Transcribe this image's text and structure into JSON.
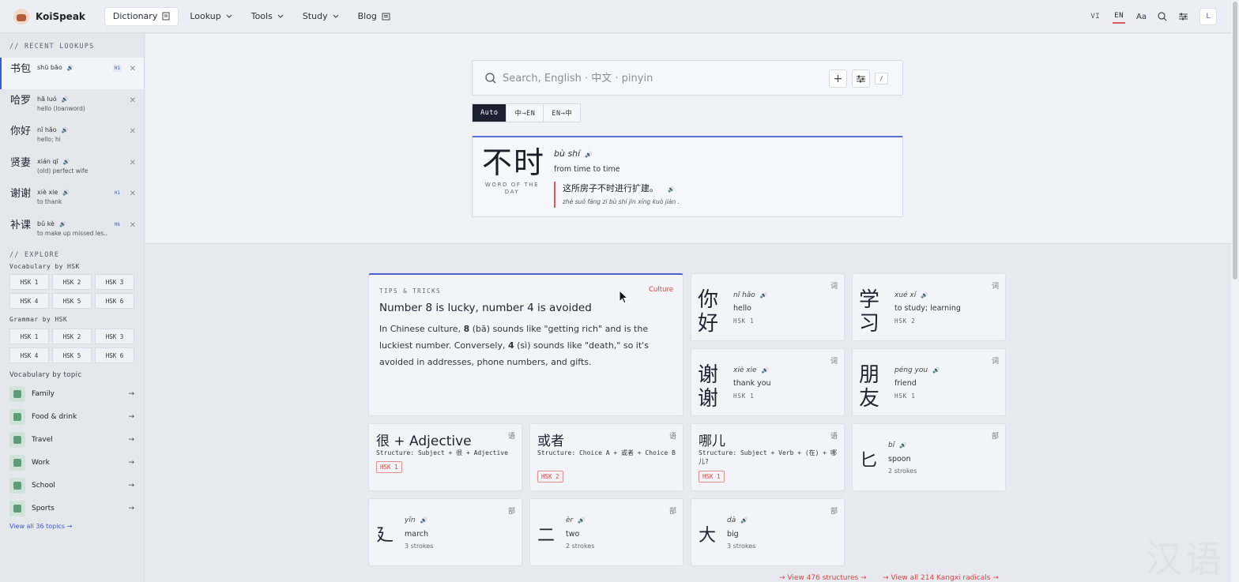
{
  "app": {
    "name": "KoiSpeak"
  },
  "nav": {
    "items": [
      {
        "label": "Dictionary"
      },
      {
        "label": "Lookup"
      },
      {
        "label": "Tools"
      },
      {
        "label": "Study"
      },
      {
        "label": "Blog"
      }
    ]
  },
  "header_right": {
    "lang_vi": "VI",
    "lang_en": "EN",
    "font_size": "Aa",
    "avatar": "L"
  },
  "sidebar": {
    "recent_heading": "// RECENT LOOKUPS",
    "recent": [
      {
        "hz": "书包",
        "py": "shū bāo",
        "mean": "",
        "hsk": "H1"
      },
      {
        "hz": "哈罗",
        "py": "hā luó",
        "mean": "hello (loanword)",
        "hsk": ""
      },
      {
        "hz": "你好",
        "py": "nǐ hǎo",
        "mean": "hello; hi",
        "hsk": ""
      },
      {
        "hz": "贤妻",
        "py": "xián qī",
        "mean": "(old) perfect wife",
        "hsk": ""
      },
      {
        "hz": "谢谢",
        "py": "xiè xie",
        "mean": "to thank",
        "hsk": "H1"
      },
      {
        "hz": "补课",
        "py": "bǔ kè",
        "mean": "to make up missed les...",
        "hsk": "H6"
      }
    ],
    "explore_heading": "// EXPLORE",
    "vocab_hsk_heading": "Vocabulary by HSK",
    "vocab_hsk": [
      "HSK 1",
      "HSK 2",
      "HSK 3",
      "HSK 4",
      "HSK 5",
      "HSK 6"
    ],
    "grammar_hsk_heading": "Grammar by HSK",
    "grammar_hsk": [
      "HSK 1",
      "HSK 2",
      "HSK 3",
      "HSK 4",
      "HSK 5",
      "HSK 6"
    ],
    "topic_heading": "Vocabulary by topic",
    "topics": [
      "Family",
      "Food & drink",
      "Travel",
      "Work",
      "School",
      "Sports"
    ],
    "view_all_topics": "View all 36 topics →"
  },
  "search": {
    "placeholder": "Search, English · 中文 · pinyin",
    "shortcut": "/"
  },
  "modes": [
    "Auto",
    "中→EN",
    "EN→中"
  ],
  "wotd": {
    "hz": "不时",
    "tag": "WORD OF THE DAY",
    "py": "bù shí",
    "mean": "from time to time",
    "example_zh": "这所房子不时进行扩建。",
    "example_py": "zhè suǒ fáng zi bù shí jìn xíng kuò jiàn ."
  },
  "tip": {
    "label": "TIPS & TRICKS",
    "category": "Culture",
    "title": "Number 8 is lucky, number 4 is avoided",
    "body_1": "In Chinese culture, ",
    "num_8": "8",
    "body_2": " (bā) sounds like \"getting rich\" and is the luckiest number. Conversely, ",
    "num_4": "4",
    "body_3": " (sì) sounds like \"death,\" so it's avoided in addresses, phone numbers, and gifts."
  },
  "word_cards": [
    {
      "hz": "你好",
      "py": "nǐ hǎo",
      "mean": "hello",
      "lvl": "HSK 1",
      "corner": "词"
    },
    {
      "hz": "学习",
      "py": "xué xí",
      "mean": "to study; learning",
      "lvl": "HSK 2",
      "corner": "词"
    },
    {
      "hz": "谢谢",
      "py": "xiè xie",
      "mean": "thank you",
      "lvl": "HSK 1",
      "corner": "词"
    },
    {
      "hz": "朋友",
      "py": "péng you",
      "mean": "friend",
      "lvl": "HSK 1",
      "corner": "词"
    }
  ],
  "grammar_cards": [
    {
      "title": "很 + Adjective",
      "struct": "Structure: Subject + 很 + Adjective",
      "badge": "HSK 1",
      "corner": "语"
    },
    {
      "title": "或者",
      "struct": "Structure: Choice A + 或者 + Choice B",
      "badge": "HSK 2",
      "corner": "语"
    },
    {
      "title": "哪儿",
      "struct": "Structure: Subject + Verb + (在) + 哪儿?",
      "badge": "HSK 1",
      "corner": "语"
    }
  ],
  "radical_cards": [
    {
      "hz": "匕",
      "py": "bǐ",
      "mean": "spoon",
      "strokes": "2 strokes",
      "corner": "部"
    },
    {
      "hz": "廴",
      "py": "yǐn",
      "mean": "march",
      "strokes": "3 strokes",
      "corner": "部"
    },
    {
      "hz": "二",
      "py": "èr",
      "mean": "two",
      "strokes": "2 strokes",
      "corner": "部"
    },
    {
      "hz": "大",
      "py": "dà",
      "mean": "big",
      "strokes": "3 strokes",
      "corner": "部"
    }
  ],
  "footer_links": {
    "structures": "→ View 476 structures →",
    "radicals": "→ View all 214 Kangxi radicals →"
  },
  "watermark": "汉语"
}
